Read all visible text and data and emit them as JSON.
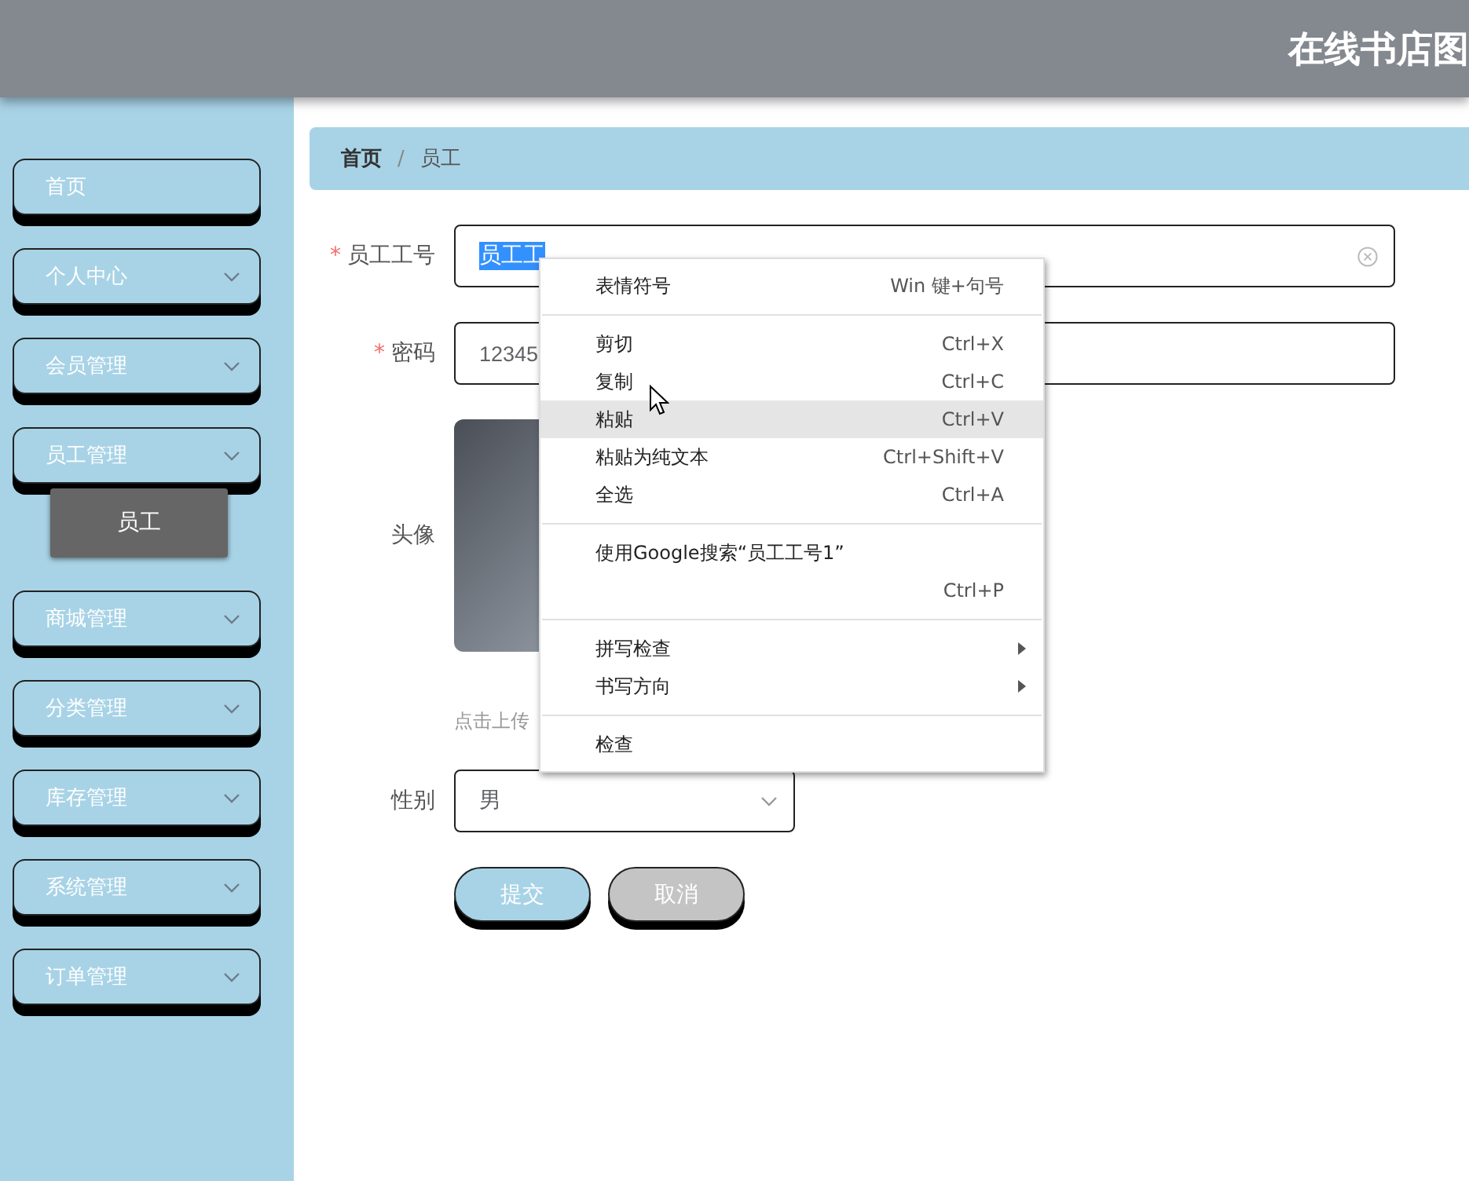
{
  "header": {
    "title": "在线书店图"
  },
  "sidebar": {
    "items": [
      {
        "label": "首页",
        "kind": "link"
      },
      {
        "label": "个人中心",
        "kind": "group"
      },
      {
        "label": "会员管理",
        "kind": "group"
      },
      {
        "label": "员工管理",
        "kind": "group",
        "children": [
          {
            "label": "员工",
            "selected": true
          }
        ]
      },
      {
        "label": "商城管理",
        "kind": "group"
      },
      {
        "label": "分类管理",
        "kind": "group"
      },
      {
        "label": "库存管理",
        "kind": "group"
      },
      {
        "label": "系统管理",
        "kind": "group"
      },
      {
        "label": "订单管理",
        "kind": "group"
      }
    ]
  },
  "breadcrumb": {
    "separator": "/",
    "items": [
      {
        "label": "首页",
        "current": false
      },
      {
        "label": "员工",
        "current": true
      }
    ]
  },
  "form": {
    "fields": [
      {
        "kind": "text",
        "required_mark": "*",
        "label": "员工工号",
        "value": "员工工",
        "text_selected": true,
        "clearable": true
      },
      {
        "kind": "text",
        "required_mark": "*",
        "label": "密码",
        "value": "12345",
        "text_selected": false,
        "clearable": false
      },
      {
        "kind": "image",
        "label": "头像",
        "hint": "点击上传"
      },
      {
        "kind": "select",
        "label": "性别",
        "value": "男"
      }
    ],
    "buttons": [
      {
        "label": "提交",
        "kind": "primary"
      },
      {
        "label": "取消",
        "kind": "secondary"
      }
    ]
  },
  "context_menu": {
    "groups": [
      [
        {
          "label": "表情符号",
          "shortcut": "Win 键+句号",
          "highlighted": false,
          "submenu": false
        }
      ],
      [
        {
          "label": "剪切",
          "shortcut": "Ctrl+X",
          "highlighted": false,
          "submenu": false
        },
        {
          "label": "复制",
          "shortcut": "Ctrl+C",
          "highlighted": false,
          "submenu": false
        },
        {
          "label": "粘贴",
          "shortcut": "Ctrl+V",
          "highlighted": true,
          "submenu": false
        },
        {
          "label": "粘贴为纯文本",
          "shortcut": "Ctrl+Shift+V",
          "highlighted": false,
          "submenu": false
        },
        {
          "label": "全选",
          "shortcut": "Ctrl+A",
          "highlighted": false,
          "submenu": false
        }
      ],
      [
        {
          "label": "使用Google搜索“员工工号1”",
          "highlighted": false,
          "submenu": false
        },
        {
          "shortcut": "Ctrl+P",
          "highlighted": false,
          "submenu": false
        }
      ],
      [
        {
          "label": "拼写检查",
          "highlighted": false,
          "submenu": true
        },
        {
          "label": "书写方向",
          "highlighted": false,
          "submenu": true
        }
      ],
      [
        {
          "label": "检查",
          "highlighted": false,
          "submenu": false
        }
      ]
    ]
  }
}
